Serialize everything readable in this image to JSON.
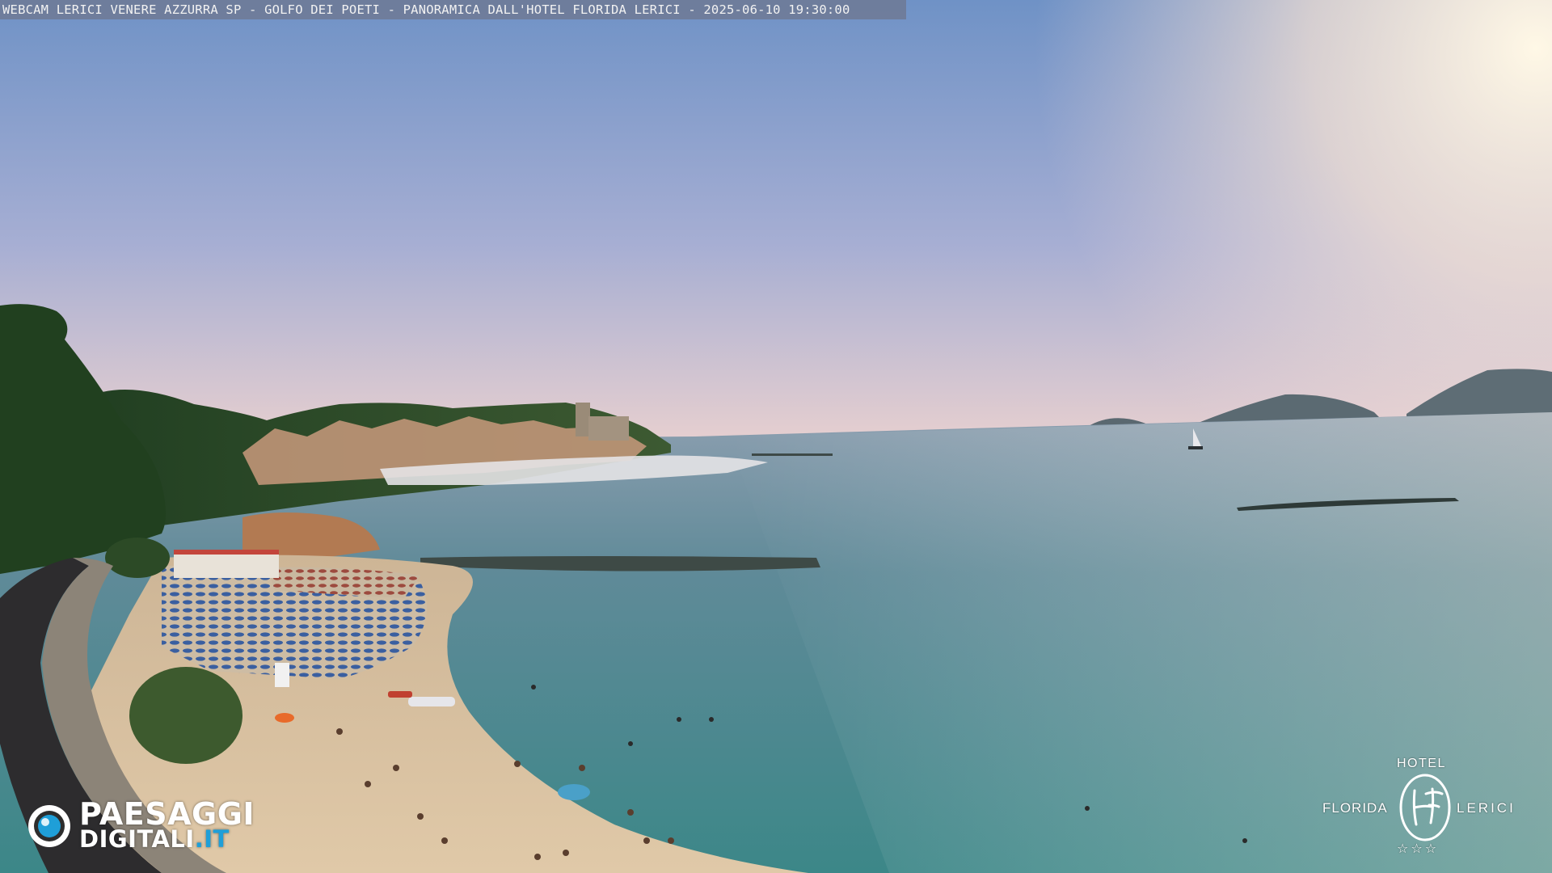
{
  "overlay": {
    "caption": "WEBCAM LERICI VENERE AZZURRA SP - GOLFO DEI POETI - PANORAMICA DALL'HOTEL FLORIDA LERICI - 2025-06-10 19:30:00"
  },
  "watermark_left": {
    "line1": "PAESAGGI",
    "line2": "DIGITALI",
    "line2_suffix": ".IT",
    "accent": "#1f9fd8"
  },
  "watermark_right": {
    "hotel": "HOTEL",
    "florida": "FLORIDA",
    "lerici": "LERICI",
    "stars": "☆☆☆"
  },
  "scene": {
    "colors": {
      "sky_top": "#6f92c6",
      "sky_horizon": "#e9d3d0",
      "sun_glow": "#fbf3e2",
      "sea_far": "#8ea6b0",
      "sea_near": "#3f8b8a",
      "beach": "#d9c2a3",
      "vegetation": "#2f4f2a",
      "umbrella": "#3a5fa0"
    }
  }
}
